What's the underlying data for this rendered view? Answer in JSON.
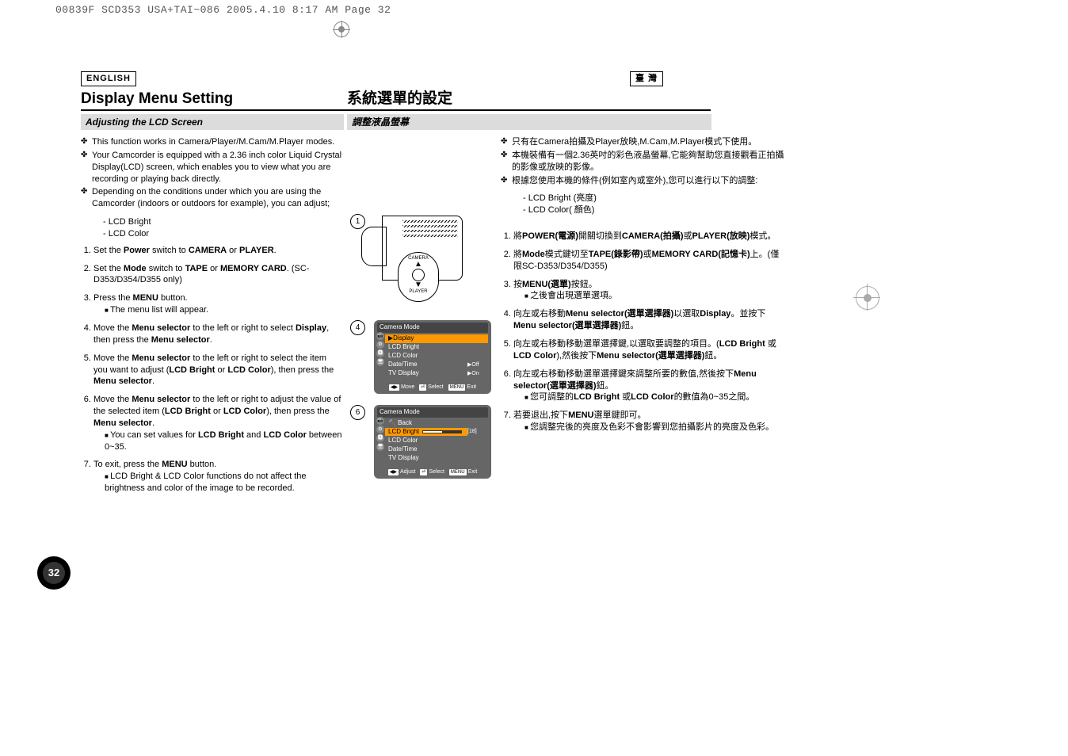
{
  "top_header": "00839F SCD353 USA+TAI~086  2005.4.10  8:17 AM  Page 32",
  "lang": {
    "left": "ENGLISH",
    "right": "臺 灣"
  },
  "title": {
    "left": "Display Menu Setting",
    "right": "系統選單的設定"
  },
  "subtitle": {
    "left": "Adjusting the LCD Screen",
    "right": "調整液晶螢幕"
  },
  "left": {
    "bullets": [
      "This function works in Camera/Player/M.Cam/M.Player modes.",
      "Your Camcorder is equipped with a 2.36 inch color Liquid Crystal Display(LCD) screen, which enables you to view what you are recording or playing back directly.",
      "Depending on the conditions under which you are using the Camcorder (indoors or outdoors for example), you can adjust;"
    ],
    "sub_dash": [
      "LCD Bright",
      "LCD Color"
    ],
    "steps": [
      {
        "t": "Set the <b>Power</b> switch to <b>CAMERA</b> or <b>PLAYER</b>."
      },
      {
        "t": "Set the <b>Mode</b> switch to <b>TAPE</b> or <b>MEMORY CARD</b>. (SC-D353/D354/D355 only)"
      },
      {
        "t": "Press the <b>MENU</b> button.",
        "sub": [
          "The menu list will appear."
        ]
      },
      {
        "t": "Move the <b>Menu selector</b> to the left or right to select <b>Display</b>, then press the <b>Menu selector</b>."
      },
      {
        "t": "Move the <b>Menu selector</b> to the left or right to select the item you want to adjust (<b>LCD Bright</b> or <b>LCD Color</b>), then press the <b>Menu selector</b>."
      },
      {
        "t": "Move the <b>Menu selector</b> to the left or right to adjust the value of the selected item (<b>LCD Bright</b> or <b>LCD Color</b>), then press the <b>Menu selector</b>.",
        "sub": [
          "You can set values for <b>LCD Bright</b> and <b>LCD Color</b> between 0~35."
        ]
      },
      {
        "t": "To exit, press the <b>MENU</b> button.",
        "sub": [
          "LCD Bright & LCD Color functions do not affect the brightness and color of the image to be recorded."
        ]
      }
    ]
  },
  "right": {
    "bullets": [
      "只有在Camera拍攝及Player放映,M.Cam,M.Player模式下使用。",
      "本機裝備有一個2.36英吋的彩色液晶螢幕,它能夠幫助您直接觀看正拍攝的影像或放映的影像。",
      "根據您使用本機的條件(例如室內或室外),您可以進行以下的調整:"
    ],
    "sub_dash": [
      "LCD Bright (亮度)",
      "LCD Color( 顏色)"
    ],
    "steps": [
      {
        "t": "將<b>POWER(電源)</b>開關切換到<b>CAMERA(拍攝)</b>或<b>PLAYER(放映)</b>模式。"
      },
      {
        "t": "將<b>Mode</b>模式鍵切至<b>TAPE(錄影帶)</b>或<b>MEMORY CARD(記憶卡)</b>上。(僅限SC-D353/D354/D355)"
      },
      {
        "t": "按<b>MENU(選單)</b>按鈕。",
        "sub": [
          "之後會出現選單選項。"
        ]
      },
      {
        "t": "向左或右移動<b>Menu selector(選單選擇器)</b>以選取<b>Display</b>。並按下<b>Menu selector(選單選擇器)</b>鈕。"
      },
      {
        "t": "向左或右移動移動選單選擇鍵,以選取要調整的項目。(<b>LCD Bright</b> 或<b>LCD Color</b>),然後按下<b>Menu selector(選單選擇器)</b>鈕。"
      },
      {
        "t": "向左或右移動移動選單選擇鍵來調整所要的數值,然後按下<b>Menu selector(選單選擇器)</b>鈕。",
        "sub": [
          "您可調整的<b>LCD Bright</b> 或<b>LCD Color</b>的數值為0~35之間。"
        ]
      },
      {
        "t": "若要退出,按下<b>MENU</b>選單鍵即可。",
        "sub": [
          "您調整完後的亮度及色彩不會影響到您拍攝影片的亮度及色彩。"
        ]
      }
    ]
  },
  "figures": {
    "switch": {
      "top": "CAMERA",
      "bottom": "PLAYER"
    },
    "osd4": {
      "title": "Camera Mode",
      "hl": "▶Display",
      "rows": [
        {
          "l": "LCD Bright",
          "v": ""
        },
        {
          "l": "LCD Color",
          "v": ""
        },
        {
          "l": "Date/Time",
          "v": "▶Off"
        },
        {
          "l": "TV Display",
          "v": "▶On"
        }
      ],
      "bottom": {
        "move": "Move",
        "select": "Select",
        "exit": "Exit",
        "menu": "MENU"
      }
    },
    "osd6": {
      "title": "Camera Mode",
      "back": "🔨 Back",
      "hl": "LCD Bright",
      "hlval": "[18]",
      "rows": [
        {
          "l": "LCD Color",
          "v": ""
        },
        {
          "l": "Date/Time",
          "v": ""
        },
        {
          "l": "TV Display",
          "v": ""
        }
      ],
      "bottom": {
        "adjust": "Adjust",
        "select": "Select",
        "exit": "Exit",
        "menu": "MENU"
      }
    },
    "nums": {
      "one": "1",
      "four": "4",
      "six": "6"
    }
  },
  "page_number": "32"
}
